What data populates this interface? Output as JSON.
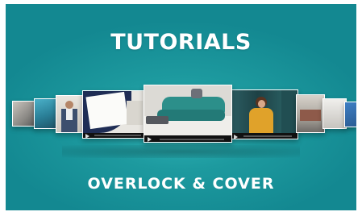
{
  "banner": {
    "title": "TUTORIALS",
    "subtitle": "OVERLOCK & COVER",
    "background_color": "#1a979c"
  },
  "carousel": {
    "cards": [
      {
        "name": "card-far-left",
        "description": ""
      },
      {
        "name": "card-left-2",
        "description": ""
      },
      {
        "name": "card-left-1",
        "description": ""
      },
      {
        "name": "card-left-near",
        "description": ""
      },
      {
        "name": "card-center",
        "description": ""
      },
      {
        "name": "card-right-near",
        "description": ""
      },
      {
        "name": "card-right-1",
        "description": ""
      },
      {
        "name": "card-right-2",
        "description": ""
      },
      {
        "name": "card-far-right",
        "description": ""
      }
    ]
  }
}
